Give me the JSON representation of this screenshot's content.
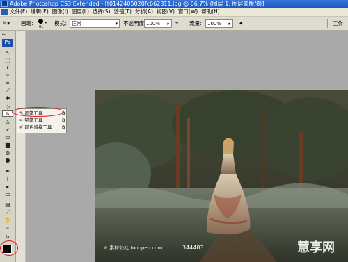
{
  "titlebar": {
    "title": "Adobe Photoshop CS3 Extended - [t0142405020fc662311.jpg @ 66.7% (图层 1, 图层蒙版/8)]"
  },
  "menubar": {
    "items": [
      "文件(F)",
      "编辑(E)",
      "图像(I)",
      "图层(L)",
      "选择(S)",
      "滤镜(T)",
      "分析(A)",
      "视图(V)",
      "窗口(W)",
      "帮助(H)"
    ]
  },
  "options": {
    "brush_label": "画笔:",
    "brush_size": "61",
    "mode_label": "模式:",
    "mode_value": "正常",
    "opacity_label": "不透明度:",
    "opacity_value": "100%",
    "flow_label": "流量:",
    "flow_value": "100%",
    "workspace": "工作"
  },
  "toolbox": {
    "logo": "Ps"
  },
  "flyout": {
    "items": [
      {
        "label": "画笔工具",
        "key": "B"
      },
      {
        "label": "铅笔工具",
        "key": "B"
      },
      {
        "label": "颜色替换工具",
        "key": "B"
      }
    ]
  },
  "watermark": {
    "site": "素材公社 tooopen.com",
    "number": "344483",
    "corner": "慧享网"
  },
  "colors": {
    "highlight_ring": "#e0141b",
    "titlebar": "#2a66cc"
  }
}
